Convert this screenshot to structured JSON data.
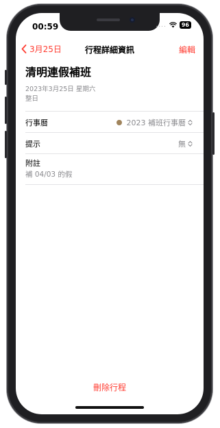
{
  "status_bar": {
    "time": "00:59",
    "signal_dots": "....",
    "battery": "96"
  },
  "nav": {
    "back_label": "3月25日",
    "title": "行程詳細資訊",
    "edit_label": "編輯"
  },
  "event": {
    "title": "清明連假補班",
    "date": "2023年3月25日 星期六",
    "all_day": "整日"
  },
  "details": {
    "calendar": {
      "label": "行事曆",
      "value": "2023 補班行事曆",
      "dot_color": "#a0845c"
    },
    "alert": {
      "label": "提示",
      "value": "無"
    },
    "notes": {
      "label": "附註",
      "text": "補 04/03 的假"
    }
  },
  "actions": {
    "delete_label": "刪除行程"
  },
  "colors": {
    "accent": "#ff3b30",
    "secondary_text": "#8a8a8e"
  },
  "icons": [
    "chevron-left-icon",
    "wifi-icon",
    "battery-icon",
    "chevron-updown-icon"
  ]
}
